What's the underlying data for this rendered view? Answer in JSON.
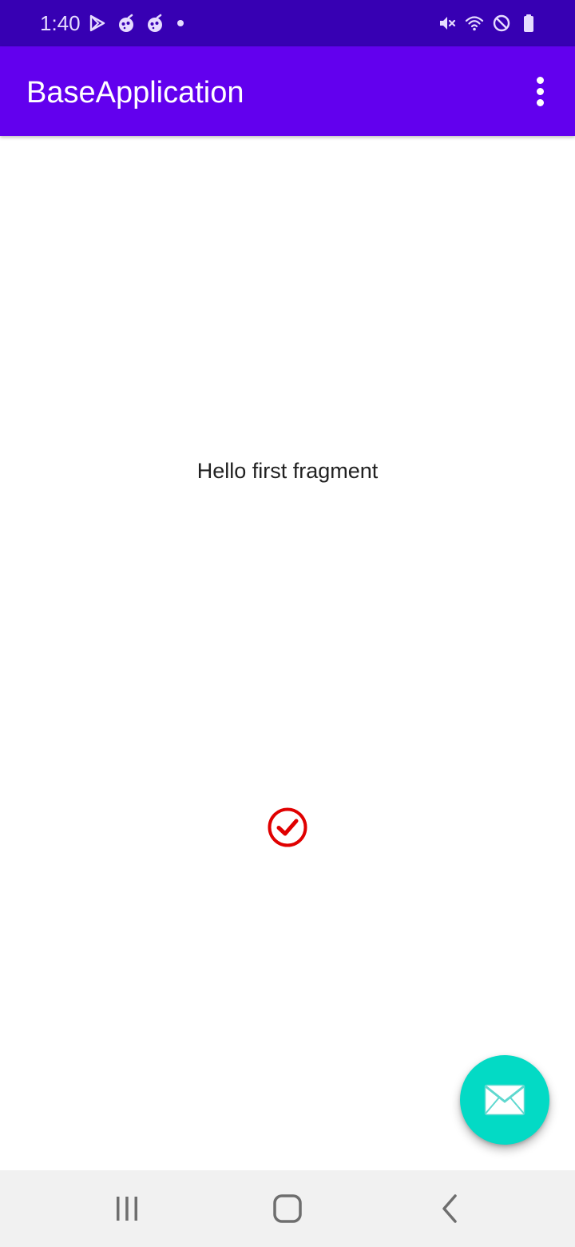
{
  "status_bar": {
    "time": "1:40",
    "left_icons": [
      "play-store-icon",
      "app-notification-icon",
      "app-notification-icon",
      "dot-icon"
    ],
    "right_icons": [
      "mute-icon",
      "wifi-icon",
      "do-not-disturb-icon",
      "battery-icon"
    ]
  },
  "app_bar": {
    "title": "BaseApplication",
    "overflow_icon": "more-vert-icon",
    "color": "#6200ee"
  },
  "content": {
    "message": "Hello first fragment",
    "check_icon": "check-circle-icon",
    "check_color": "#e00000"
  },
  "fab": {
    "icon": "email-icon",
    "color": "#03dac5"
  },
  "nav_bar": {
    "buttons": [
      "recents-icon",
      "home-icon",
      "back-icon"
    ]
  }
}
